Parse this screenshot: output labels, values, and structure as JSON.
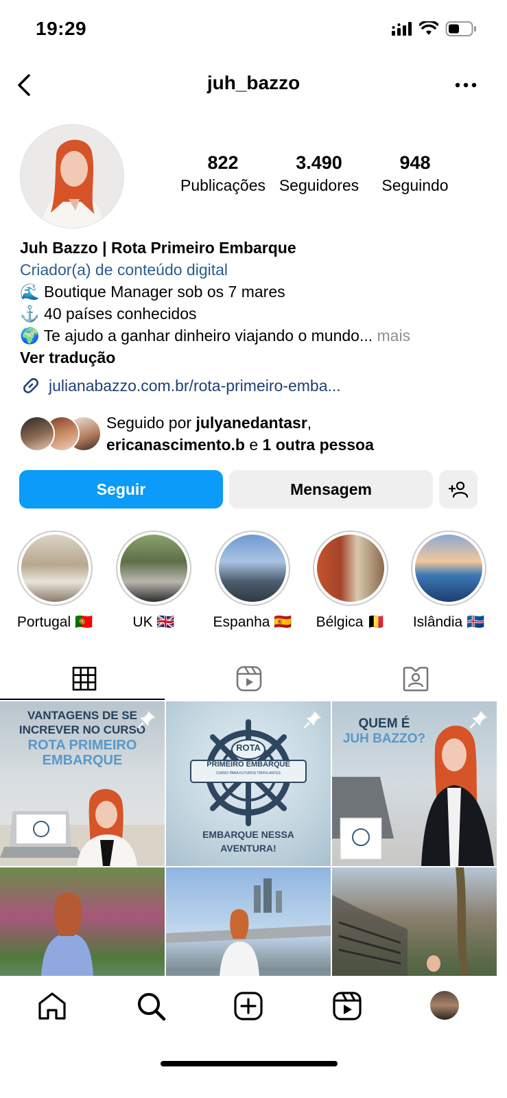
{
  "status_bar": {
    "time": "19:29"
  },
  "header": {
    "username": "juh_bazzo"
  },
  "stats": [
    {
      "value": "822",
      "label": "Publicações"
    },
    {
      "value": "3.490",
      "label": "Seguidores"
    },
    {
      "value": "948",
      "label": "Seguindo"
    }
  ],
  "bio": {
    "name": "Juh Bazzo | Rota Primeiro Embarque",
    "category": "Criador(a) de conteúdo digital",
    "line1": "🌊 Boutique Manager sob os 7 mares",
    "line2": "⚓️ 40 países conhecidos",
    "line3": "🌍 Te ajudo a ganhar dinheiro viajando o mundo...",
    "more": "mais",
    "translate": "Ver tradução",
    "link": "julianabazzo.com.br/rota-primeiro-emba..."
  },
  "followed_by": {
    "prefix": "Seguido por ",
    "user1": "julyanedantasr",
    "sep": ",",
    "user2": "ericanascimento.b",
    "and": " e ",
    "others": "1 outra pessoa"
  },
  "buttons": {
    "follow": "Seguir",
    "message": "Mensagem"
  },
  "highlights": [
    {
      "label": "Portugal 🇵🇹"
    },
    {
      "label": "UK 🇬🇧"
    },
    {
      "label": "Espanha 🇪🇸"
    },
    {
      "label": "Bélgica 🇧🇪"
    },
    {
      "label": "Islândia 🇮🇸"
    }
  ],
  "posts": {
    "p1": {
      "line1": "VANTAGENS DE SE",
      "line2": "INCREVER NO CURSO",
      "line3": "ROTA PRIMEIRO",
      "line4": "EMBARQUE"
    },
    "p2": {
      "badge1": "ROTA",
      "badge2": "PRIMEIRO EMBARQUE",
      "badge3": "CURSO PARA FUTUROS TRIPULANTES",
      "line1": "EMBARQUE NESSA",
      "line2": "AVENTURA!"
    },
    "p3": {
      "line1": "QUEM É",
      "line2": "JUH BAZZO?"
    }
  },
  "colors": {
    "follow": "#0b9bf8",
    "link": "#1f3f74",
    "category": "#2b5b8e"
  }
}
